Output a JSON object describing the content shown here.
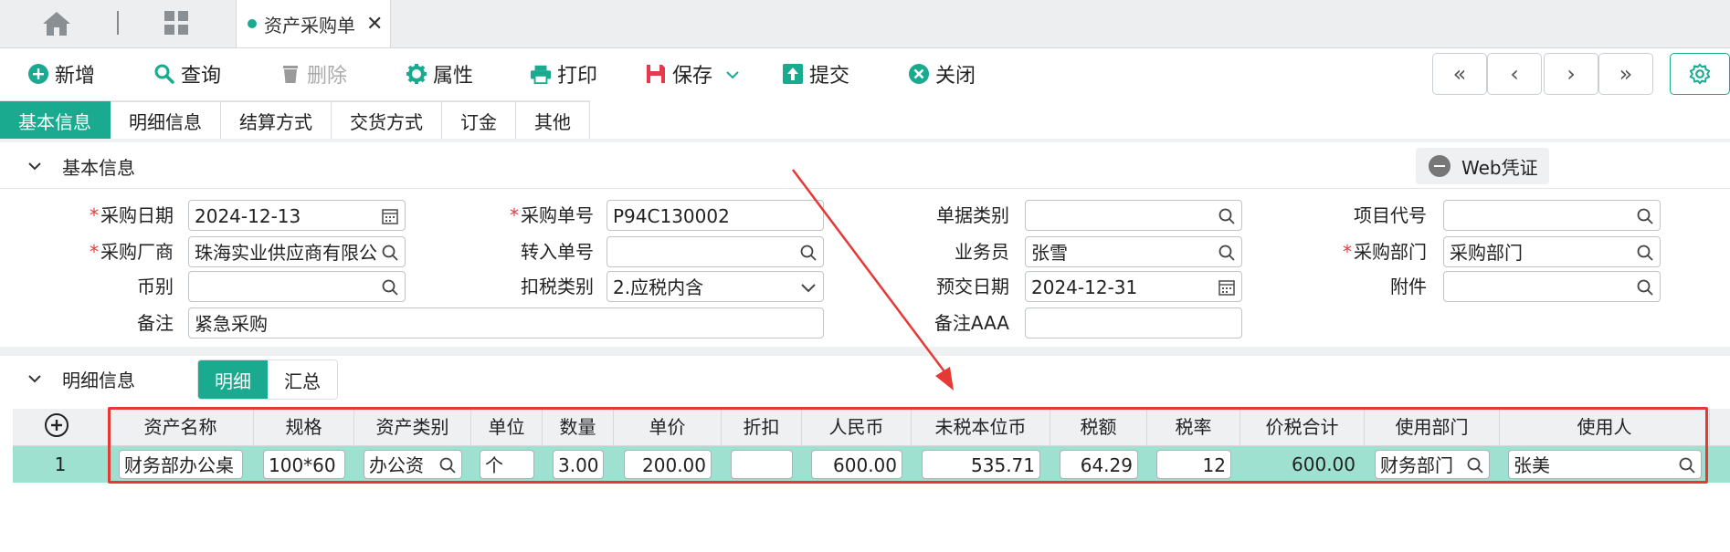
{
  "tabbar": {
    "doc_tab_title": "资产采购单",
    "close_glyph": "✕"
  },
  "toolbar": {
    "add": "新增",
    "query": "查询",
    "delete": "删除",
    "properties": "属性",
    "print": "打印",
    "save": "保存",
    "submit": "提交",
    "close": "关闭",
    "nav_first": "«",
    "nav_prev": "‹",
    "nav_next": "›",
    "nav_last": "»"
  },
  "section_tabs": [
    "基本信息",
    "明细信息",
    "结算方式",
    "交货方式",
    "订金",
    "其他"
  ],
  "basic_section": {
    "title": "基本信息",
    "web_voucher_button": "Web凭证"
  },
  "form": {
    "purchase_date": {
      "label": "采购日期",
      "value": "2024-12-13"
    },
    "purchase_no": {
      "label": "采购单号",
      "value": "P94C130002"
    },
    "doc_type": {
      "label": "单据类别",
      "value": ""
    },
    "project_code": {
      "label": "项目代号",
      "value": ""
    },
    "vendor": {
      "label": "采购厂商",
      "value": "珠海实业供应商有限公"
    },
    "transfer_no": {
      "label": "转入单号",
      "value": ""
    },
    "salesperson": {
      "label": "业务员",
      "value": "张雪"
    },
    "purchase_dept": {
      "label": "采购部门",
      "value": "采购部门"
    },
    "currency": {
      "label": "币别",
      "value": ""
    },
    "tax_type": {
      "label": "扣税类别",
      "value": "2.应税内含"
    },
    "expected_date": {
      "label": "预交日期",
      "value": "2024-12-31"
    },
    "attachment": {
      "label": "附件",
      "value": ""
    },
    "remark": {
      "label": "备注",
      "value": "紧急采购"
    },
    "remark_aaa": {
      "label": "备注AAA",
      "value": ""
    }
  },
  "detail_section": {
    "title": "明细信息",
    "tab_detail": "明细",
    "tab_summary": "汇总"
  },
  "grid": {
    "columns": [
      "资产名称",
      "规格",
      "资产类别",
      "单位",
      "数量",
      "单价",
      "折扣",
      "人民币",
      "未税本位币",
      "税额",
      "税率",
      "价税合计",
      "使用部门",
      "使用人"
    ],
    "rows": [
      {
        "row_no": "1",
        "asset_name": "财务部办公桌",
        "spec": "100*60",
        "category": "办公资",
        "unit": "个",
        "qty": "3.00",
        "unit_price": "200.00",
        "discount": "",
        "rmb": "600.00",
        "pretax": "535.71",
        "tax": "64.29",
        "tax_rate": "12",
        "total": "600.00",
        "dept": "财务部门",
        "user": "张美"
      }
    ]
  },
  "colors": {
    "accent": "#1aaa8f",
    "row_highlight": "#9fe1d0",
    "annotation": "#e53935"
  }
}
